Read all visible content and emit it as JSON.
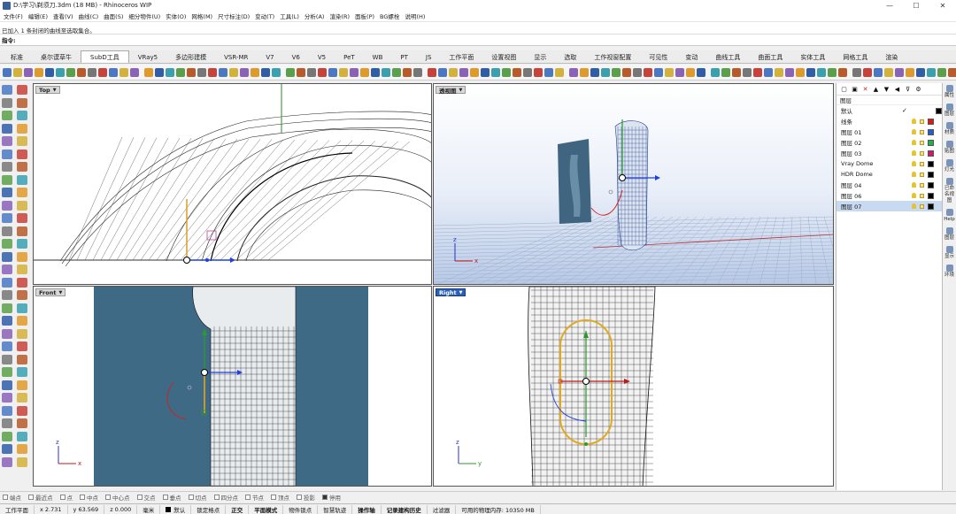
{
  "window": {
    "title": "D:\\学习\\剃须刀.3dm (18 MB) - Rhinoceros WIP",
    "controls": [
      "—",
      "☐",
      "✕"
    ]
  },
  "menu": [
    "文件(F)",
    "编辑(E)",
    "查看(V)",
    "曲线(C)",
    "曲面(S)",
    "细分物件(U)",
    "实体(O)",
    "网格(M)",
    "尺寸标注(D)",
    "变动(T)",
    "工具(L)",
    "分析(A)",
    "渲染(R)",
    "面板(P)",
    "BG螺栓",
    "说明(H)"
  ],
  "command": {
    "history": "已加入 1 条封闭的曲线至选取集合。",
    "prompt": "指令:"
  },
  "tabs": [
    {
      "label": "标准",
      "active": false
    },
    {
      "label": "桌尔谟草牛",
      "active": false
    },
    {
      "label": "SubD工具",
      "active": true
    },
    {
      "label": "VRay5",
      "active": false
    },
    {
      "label": "多边形建模",
      "active": false
    },
    {
      "label": "VSR-MR",
      "active": false
    },
    {
      "label": "V7",
      "active": false
    },
    {
      "label": "V6",
      "active": false
    },
    {
      "label": "V5",
      "active": false
    },
    {
      "label": "PeT",
      "active": false
    },
    {
      "label": "WB",
      "active": false
    },
    {
      "label": "PT",
      "active": false
    },
    {
      "label": "JS",
      "active": false
    },
    {
      "label": "工作平面",
      "active": false
    },
    {
      "label": "设置视图",
      "active": false
    },
    {
      "label": "显示",
      "active": false
    },
    {
      "label": "选取",
      "active": false
    },
    {
      "label": "工作视窗配置",
      "active": false
    },
    {
      "label": "可见性",
      "active": false
    },
    {
      "label": "变动",
      "active": false
    },
    {
      "label": "曲线工具",
      "active": false
    },
    {
      "label": "曲面工具",
      "active": false
    },
    {
      "label": "实体工具",
      "active": false
    },
    {
      "label": "网格工具",
      "active": false
    },
    {
      "label": "渲染",
      "active": false
    }
  ],
  "viewports": {
    "top": {
      "label": "Top",
      "active": false
    },
    "perspective": {
      "label": "透视图",
      "active": false
    },
    "front": {
      "label": "Front",
      "active": false
    },
    "right": {
      "label": "Right",
      "active": true
    }
  },
  "axes": {
    "x": "x",
    "y": "y",
    "z": "z"
  },
  "layers": {
    "header": "图层",
    "rows": [
      {
        "name": "默认",
        "color": "#000000",
        "current": true,
        "selected": false
      },
      {
        "name": "线条",
        "color": "#e01818",
        "current": false,
        "selected": false
      },
      {
        "name": "图层 01",
        "color": "#2060d0",
        "current": false,
        "selected": false
      },
      {
        "name": "图层 02",
        "color": "#22b04a",
        "current": false,
        "selected": false
      },
      {
        "name": "图层 03",
        "color": "#d0186e",
        "current": false,
        "selected": false
      },
      {
        "name": "Vray Dome",
        "color": "#000000",
        "current": false,
        "selected": false
      },
      {
        "name": "HDR Dome",
        "color": "#000000",
        "current": false,
        "selected": false
      },
      {
        "name": "图层 04",
        "color": "#000000",
        "current": false,
        "selected": false
      },
      {
        "name": "图层 06",
        "color": "#000000",
        "current": false,
        "selected": false
      },
      {
        "name": "图层 07",
        "color": "#000000",
        "current": false,
        "selected": true
      }
    ]
  },
  "side_tabs": [
    "属性",
    "图层",
    "材质",
    "贴图",
    "灯光",
    "已命名视图",
    "Help",
    "图层",
    "显示",
    "环境"
  ],
  "osnap": [
    {
      "label": "端点",
      "on": false
    },
    {
      "label": "最近点",
      "on": false
    },
    {
      "label": "点",
      "on": false
    },
    {
      "label": "中点",
      "on": false
    },
    {
      "label": "中心点",
      "on": false
    },
    {
      "label": "交点",
      "on": false
    },
    {
      "label": "垂点",
      "on": false
    },
    {
      "label": "切点",
      "on": false
    },
    {
      "label": "四分点",
      "on": false
    },
    {
      "label": "节点",
      "on": false
    },
    {
      "label": "顶点",
      "on": false
    },
    {
      "label": "投影",
      "on": false
    },
    {
      "label": "停用",
      "on": true
    }
  ],
  "status": {
    "cplane": "工作平面",
    "x": "x 2.731",
    "y": "y 63.569",
    "z": "z 0.000",
    "unit": "毫米",
    "layer": "默认",
    "items": [
      "锁定格点",
      "正交",
      "平面模式",
      "物件锁点",
      "智慧轨迹",
      "操作轴",
      "记录建构历史",
      "过滤器"
    ],
    "memory": "可用的物理内存: 10350 MB"
  }
}
